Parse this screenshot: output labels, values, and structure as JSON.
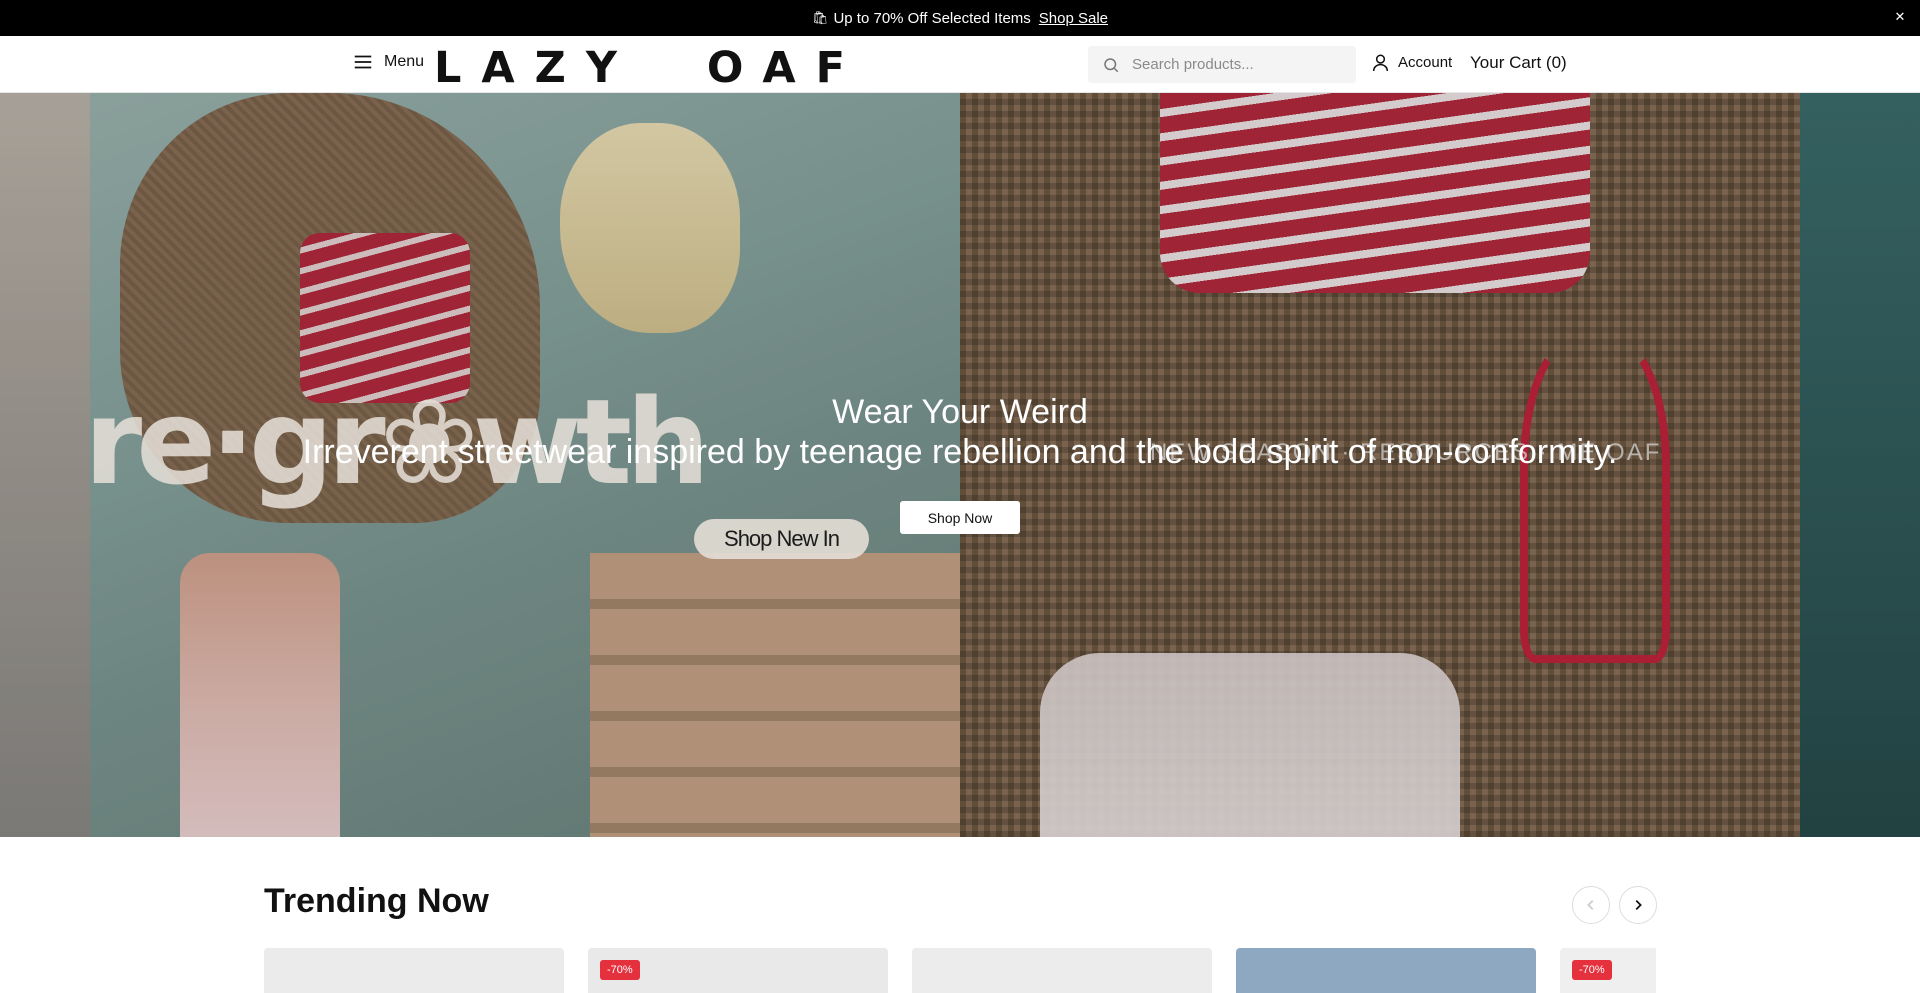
{
  "announcement": {
    "icon": "🛍",
    "text": "Up to 70% Off Selected Items",
    "link_label": "Shop Sale",
    "close_glyph": "✕"
  },
  "header": {
    "menu_label": "Menu",
    "logo_text": "LAZY  OAF",
    "search_placeholder": "Search products...",
    "account_label": "Account",
    "cart_label": "Your Cart (0)"
  },
  "hero": {
    "title": "Wear Your Weird",
    "subtitle": "Irreverent streetwear inspired by teenage rebellion and the bold spirit of non-conformity.",
    "cta_label": "Shop Now",
    "left_banner": {
      "headline": "re·gr❀wth",
      "button_label": "Shop New In"
    },
    "right_banner": {
      "tagline": "NEW SEASON · RESOURCES · ME OAF"
    }
  },
  "trending": {
    "title": "Trending Now",
    "prev_glyph": "‹",
    "next_glyph": "›",
    "products": [
      {
        "badge": "",
        "bg": "#ebebeb"
      },
      {
        "badge": "-70%",
        "bg": "#e9e9e9"
      },
      {
        "badge": "",
        "bg": "#ececec"
      },
      {
        "badge": "",
        "bg": "#8fa8c2"
      },
      {
        "badge": "-70%",
        "bg": "#efefef"
      }
    ]
  },
  "colors": {
    "announcement_bg": "#000000",
    "sale_badge": "#e5303d",
    "accent_red": "#b5293e"
  }
}
